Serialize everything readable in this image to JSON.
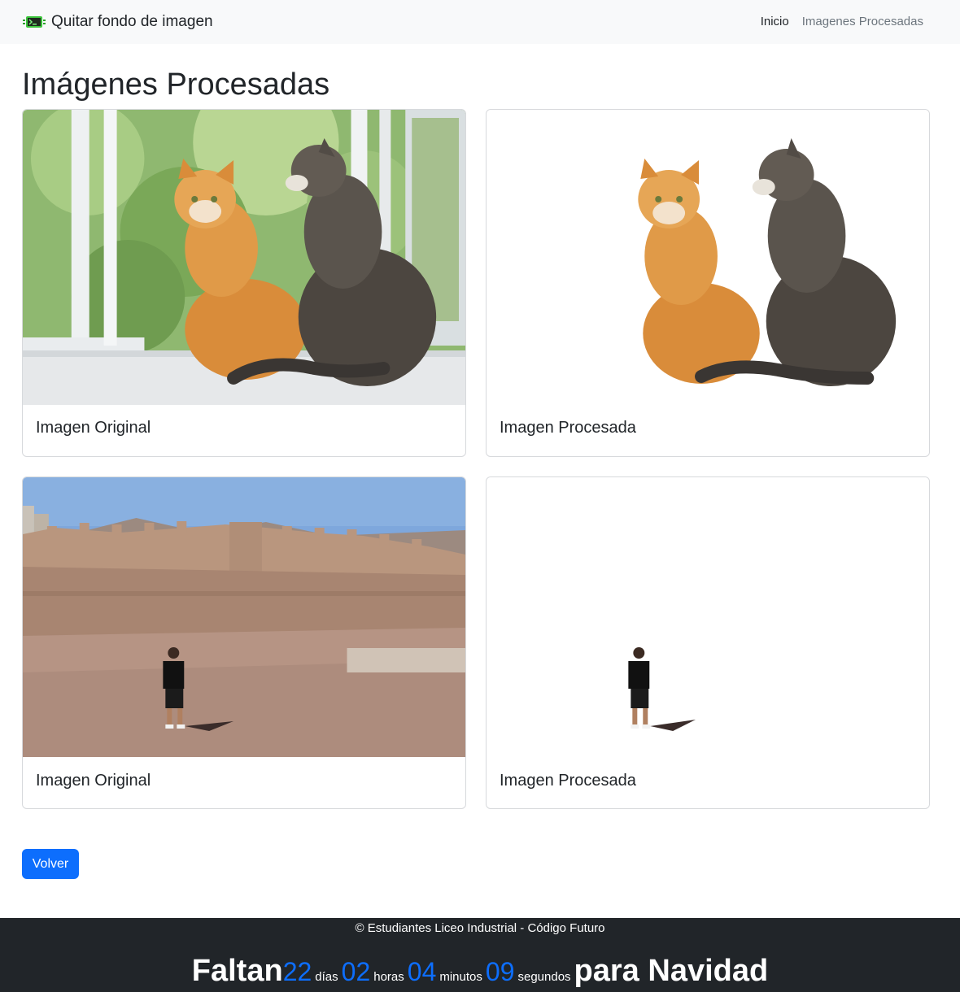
{
  "navbar": {
    "brand": "Quitar fondo de imagen",
    "brand_icon": "terminal-icon",
    "links": [
      {
        "label": "Inicio",
        "active": true
      },
      {
        "label": "Imagenes Procesadas",
        "active": false
      }
    ]
  },
  "page": {
    "title": "Imágenes Procesadas"
  },
  "cards": [
    {
      "title": "Imagen Original",
      "image": "cats-by-window-photo"
    },
    {
      "title": "Imagen Procesada",
      "image": "cats-background-removed"
    },
    {
      "title": "Imagen Original",
      "image": "man-at-fortress-ruins-photo"
    },
    {
      "title": "Imagen Procesada",
      "image": "man-background-removed"
    }
  ],
  "actions": {
    "back_label": "Volver"
  },
  "footer": {
    "copyright": "© Estudiantes Liceo Industrial - Código Futuro",
    "countdown": {
      "prefix": "Faltan",
      "days": "22",
      "days_label": "días",
      "hours": "02",
      "hours_label": "horas",
      "minutes": "04",
      "minutes_label": "minutos",
      "seconds": "09",
      "seconds_label": "segundos",
      "suffix": "para Navidad"
    }
  },
  "colors": {
    "primary": "#0d6efd",
    "navbar_bg": "#f8f9fa",
    "footer_bg": "#212529",
    "muted": "#6c757d"
  }
}
